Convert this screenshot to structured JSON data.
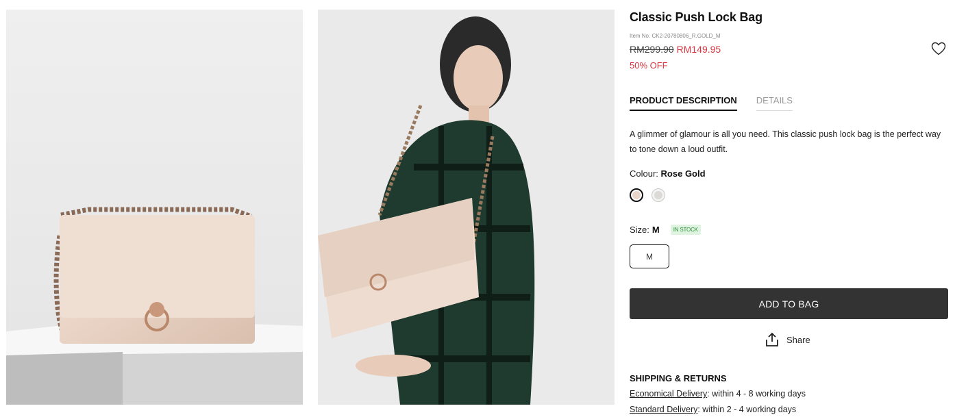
{
  "images": {
    "photo1_alt": "Classic Push Lock Bag - product shot",
    "photo2_alt": "Classic Push Lock Bag - model shot"
  },
  "product": {
    "title": "Classic Push Lock Bag",
    "item_no": "Item No. CK2-20780806_R.GOLD_M",
    "old_price": "RM299.90",
    "new_price": "RM149.95",
    "discount": "50% OFF",
    "wishlist_icon": "heart-icon"
  },
  "tabs": [
    {
      "label": "PRODUCT DESCRIPTION",
      "active": true
    },
    {
      "label": "DETAILS",
      "active": false
    }
  ],
  "description": "A glimmer of glamour is all you need. This classic push lock bag is the perfect way to tone down a loud outfit.",
  "colour": {
    "label": "Colour:",
    "value": "Rose Gold",
    "swatches": [
      {
        "name": "Rose Gold",
        "color": "#e8d4c8",
        "selected": true
      },
      {
        "name": "Silver",
        "color": "#dcdad6",
        "selected": false
      }
    ]
  },
  "size": {
    "label": "Size:",
    "value": "M",
    "stock_badge": "IN STOCK",
    "options": [
      "M"
    ]
  },
  "actions": {
    "add_to_bag": "ADD TO BAG",
    "share": "Share"
  },
  "shipping": {
    "title": "SHIPPING & RETURNS",
    "lines": [
      {
        "link": "Economical Delivery",
        "text": ": within 4 - 8 working days"
      },
      {
        "link": "Standard Delivery",
        "text": ": within 2 - 4 working days"
      }
    ]
  },
  "colors": {
    "accent_red": "#d6353f",
    "button_dark": "#333333",
    "stock_green": "#2f8f3a"
  }
}
